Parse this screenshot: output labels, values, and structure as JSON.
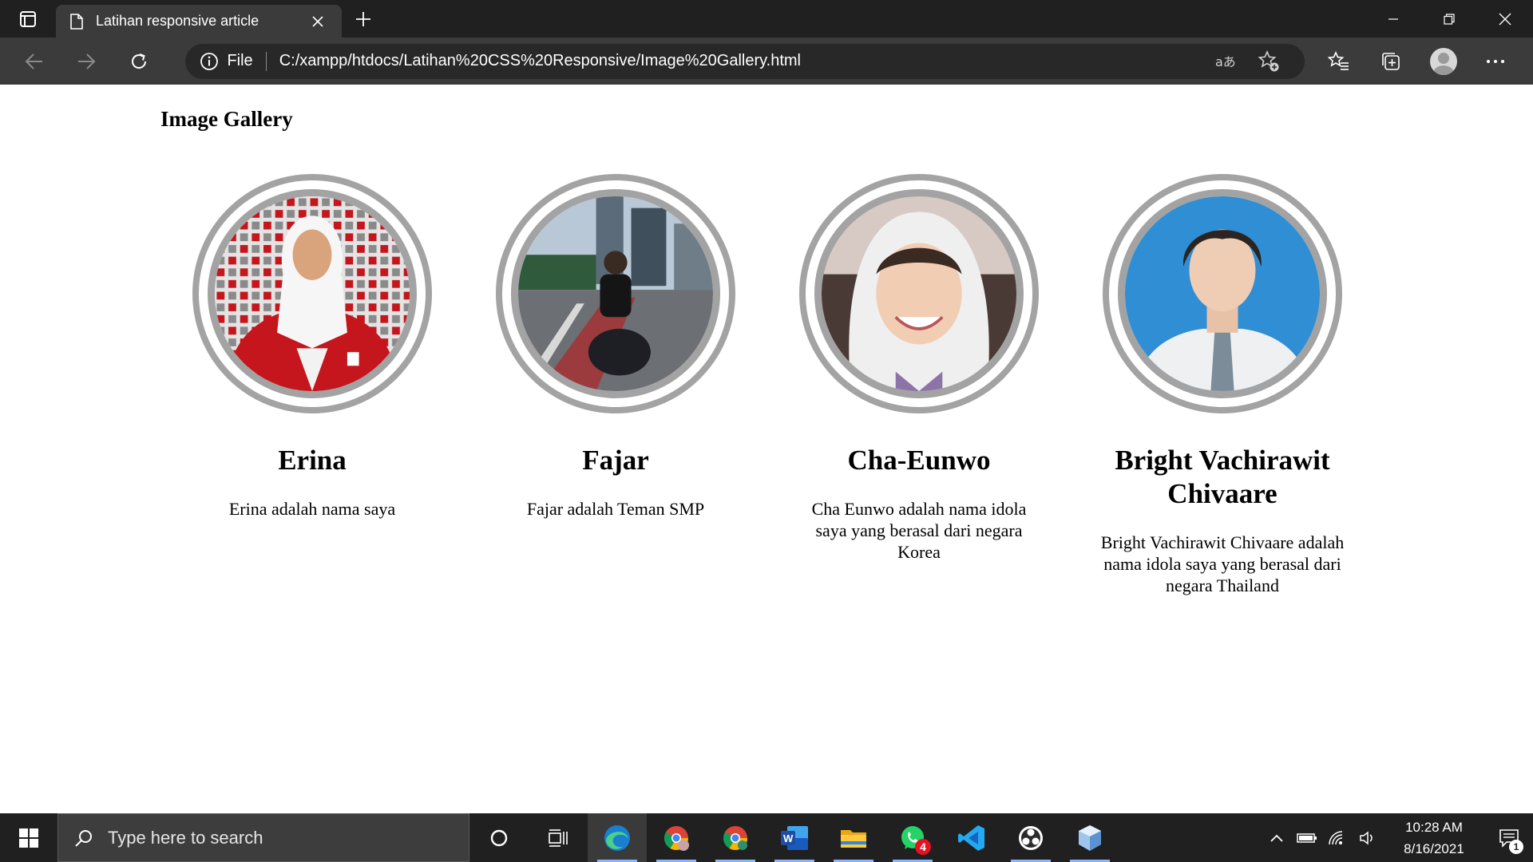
{
  "browser": {
    "tab_title": "Latihan responsive article",
    "address_scheme_label": "File",
    "url": "C:/xampp/htdocs/Latihan%20CSS%20Responsive/Image%20Gallery.html"
  },
  "page": {
    "title": "Image Gallery",
    "cards": [
      {
        "name": "Erina",
        "description": "Erina adalah nama saya"
      },
      {
        "name": "Fajar",
        "description": "Fajar adalah Teman SMP"
      },
      {
        "name": "Cha-Eunwo",
        "description": "Cha Eunwo adalah nama idola saya yang berasal dari negara Korea"
      },
      {
        "name": "Bright Vachirawit Chivaare",
        "description": "Bright Vachirawit Chivaare adalah nama idola saya yang berasal dari negara Thailand"
      }
    ]
  },
  "taskbar": {
    "search_placeholder": "Type here to search",
    "whatsapp_badge": "4",
    "time": "10:28 AM",
    "date": "8/16/2021",
    "notification_count": "1"
  },
  "colors": {
    "ring": "#a3a3a3",
    "chrome_dark": "#202020",
    "chrome_toolbar": "#3b3b3b",
    "address_bg": "#282828",
    "taskbar_search": "#3d3d3d"
  }
}
